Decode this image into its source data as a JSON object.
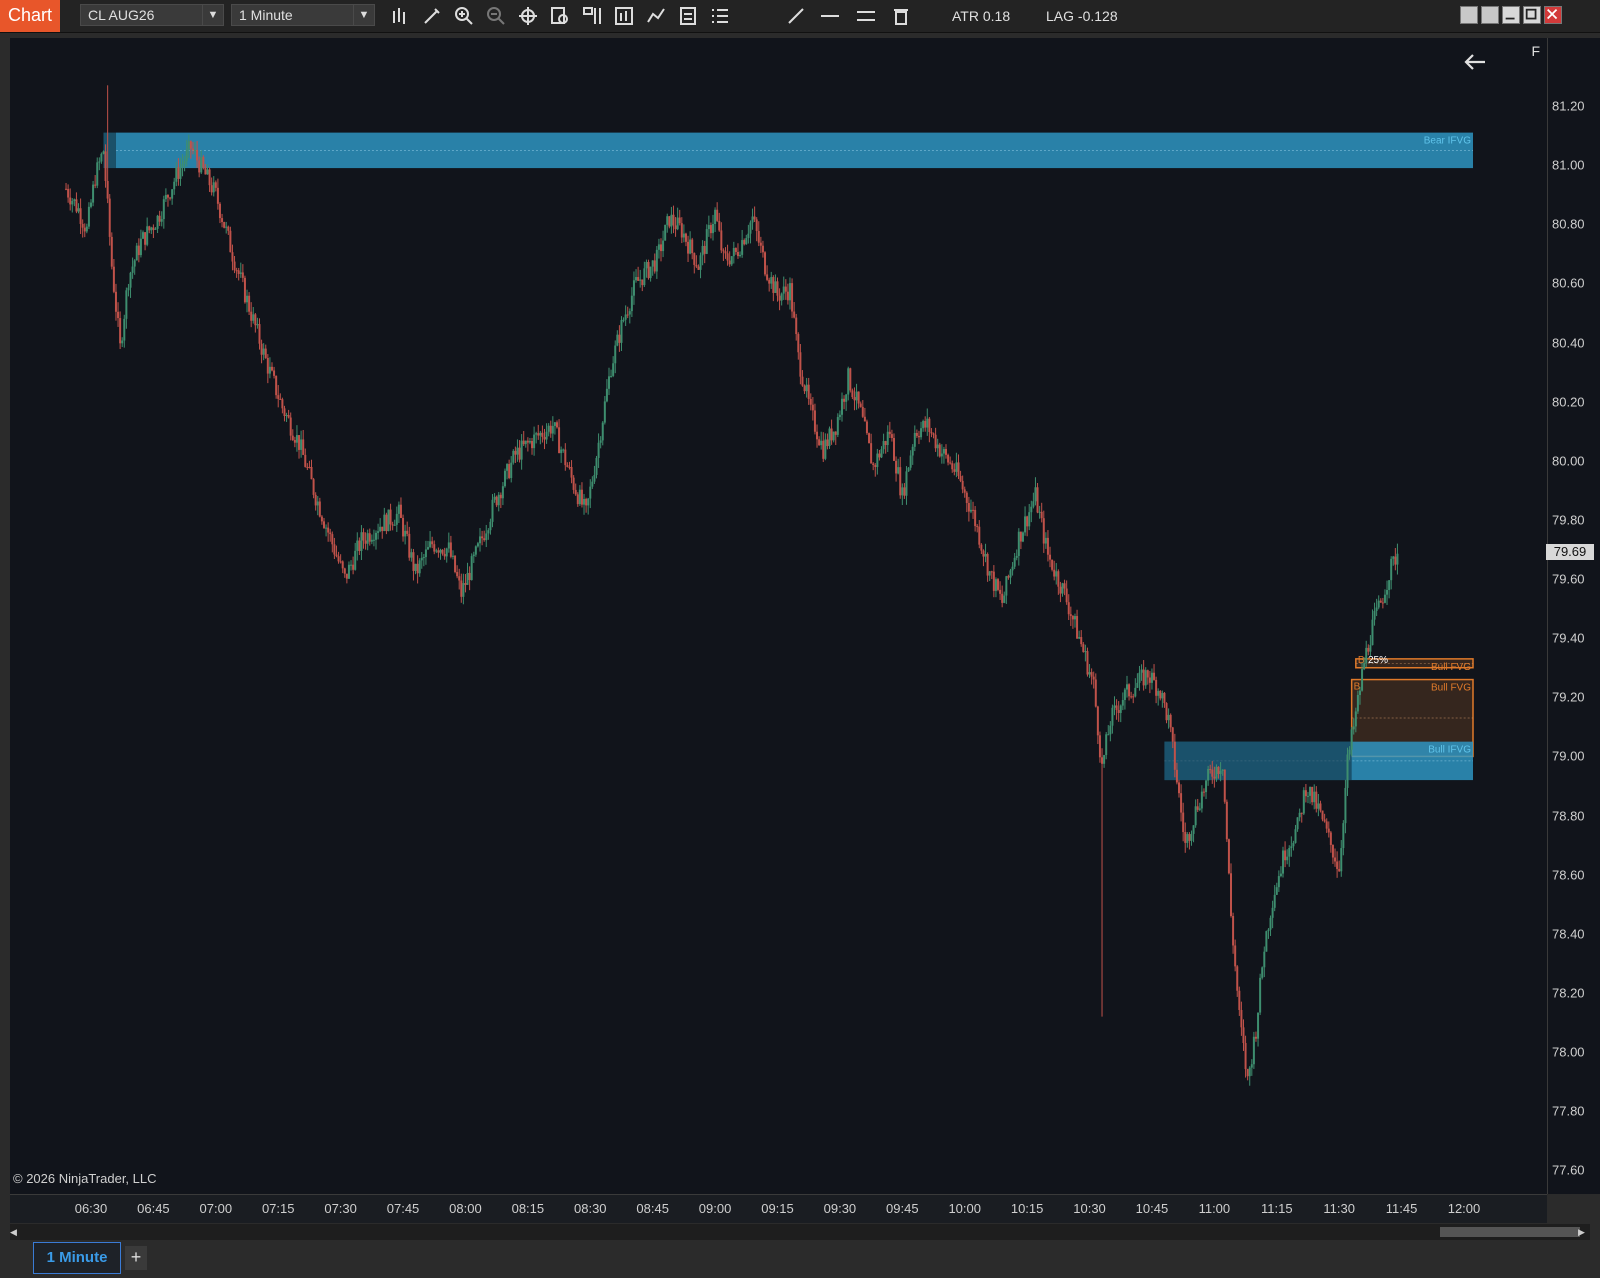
{
  "toolbar": {
    "app_label": "Chart",
    "instrument": "CL AUG26",
    "interval": "1 Minute",
    "atr": "ATR 0.18",
    "lag": "LAG -0.128"
  },
  "chart": {
    "copyright": "© 2026 NinjaTrader, LLC",
    "f_label": "F",
    "last_price": "79.69",
    "zones": {
      "bear_ifvg": "Bear IFVG",
      "bull_fvg_1": "Bull FVG",
      "bull_fvg_2": "Bull FVG",
      "bull_ifvg": "Bull IFVG",
      "pct_label": "25%",
      "marker_b1": "B",
      "marker_b2": "B"
    }
  },
  "chart_data": {
    "type": "candlestick",
    "xlabel": "",
    "ylabel": "",
    "x_ticks": [
      "06:30",
      "06:45",
      "07:00",
      "07:15",
      "07:30",
      "07:45",
      "08:00",
      "08:15",
      "08:30",
      "08:45",
      "09:00",
      "09:15",
      "09:30",
      "09:45",
      "10:00",
      "10:15",
      "10:30",
      "10:45",
      "11:00",
      "11:15",
      "11:30",
      "11:45",
      "12:00"
    ],
    "y_ticks": [
      "81.20",
      "81.00",
      "80.80",
      "80.60",
      "80.40",
      "80.20",
      "80.00",
      "79.80",
      "79.60",
      "79.40",
      "79.20",
      "79.00",
      "78.80",
      "78.60",
      "78.40",
      "78.20",
      "78.00",
      "77.80",
      "77.60"
    ],
    "ylim": [
      77.52,
      81.43
    ],
    "close_path": [
      [
        "06:24",
        80.92
      ],
      [
        "06:27",
        80.85
      ],
      [
        "06:29",
        80.78
      ],
      [
        "06:31",
        80.96
      ],
      [
        "06:33",
        81.05
      ],
      [
        "06:35",
        80.66
      ],
      [
        "06:37",
        80.38
      ],
      [
        "06:39",
        80.62
      ],
      [
        "06:42",
        80.74
      ],
      [
        "06:46",
        80.82
      ],
      [
        "06:51",
        80.98
      ],
      [
        "06:54",
        81.06
      ],
      [
        "06:57",
        80.98
      ],
      [
        "07:00",
        80.9
      ],
      [
        "07:04",
        80.7
      ],
      [
        "07:08",
        80.52
      ],
      [
        "07:12",
        80.34
      ],
      [
        "07:16",
        80.18
      ],
      [
        "07:20",
        80.06
      ],
      [
        "07:24",
        79.88
      ],
      [
        "07:28",
        79.72
      ],
      [
        "07:31",
        79.6
      ],
      [
        "07:35",
        79.73
      ],
      [
        "07:39",
        79.78
      ],
      [
        "07:44",
        79.82
      ],
      [
        "07:48",
        79.62
      ],
      [
        "07:52",
        79.72
      ],
      [
        "07:56",
        79.7
      ],
      [
        "07:59",
        79.55
      ],
      [
        "08:03",
        79.7
      ],
      [
        "08:07",
        79.86
      ],
      [
        "08:12",
        80.02
      ],
      [
        "08:17",
        80.08
      ],
      [
        "08:21",
        80.12
      ],
      [
        "08:26",
        79.92
      ],
      [
        "08:29",
        79.82
      ],
      [
        "08:32",
        80.06
      ],
      [
        "08:35",
        80.32
      ],
      [
        "08:38",
        80.48
      ],
      [
        "08:41",
        80.6
      ],
      [
        "08:46",
        80.68
      ],
      [
        "08:49",
        80.82
      ],
      [
        "08:52",
        80.78
      ],
      [
        "08:56",
        80.66
      ],
      [
        "09:00",
        80.84
      ],
      [
        "09:02",
        80.68
      ],
      [
        "09:05",
        80.7
      ],
      [
        "09:09",
        80.82
      ],
      [
        "09:12",
        80.66
      ],
      [
        "09:15",
        80.56
      ],
      [
        "09:18",
        80.58
      ],
      [
        "09:20",
        80.35
      ],
      [
        "09:23",
        80.16
      ],
      [
        "09:26",
        80.04
      ],
      [
        "09:29",
        80.12
      ],
      [
        "09:32",
        80.28
      ],
      [
        "09:35",
        80.16
      ],
      [
        "09:38",
        79.98
      ],
      [
        "09:42",
        80.1
      ],
      [
        "09:45",
        79.88
      ],
      [
        "09:48",
        80.1
      ],
      [
        "09:51",
        80.12
      ],
      [
        "09:54",
        80.04
      ],
      [
        "09:58",
        79.96
      ],
      [
        "10:02",
        79.82
      ],
      [
        "10:06",
        79.62
      ],
      [
        "10:09",
        79.52
      ],
      [
        "10:13",
        79.74
      ],
      [
        "10:17",
        79.88
      ],
      [
        "10:20",
        79.68
      ],
      [
        "10:24",
        79.55
      ],
      [
        "10:28",
        79.38
      ],
      [
        "10:31",
        79.24
      ],
      [
        "10:33",
        78.96
      ],
      [
        "10:35",
        79.12
      ],
      [
        "10:38",
        79.2
      ],
      [
        "10:41",
        79.24
      ],
      [
        "10:44",
        79.28
      ],
      [
        "10:47",
        79.22
      ],
      [
        "10:49",
        79.12
      ],
      [
        "10:51",
        78.92
      ],
      [
        "10:53",
        78.7
      ],
      [
        "10:56",
        78.84
      ],
      [
        "10:59",
        78.94
      ],
      [
        "11:02",
        78.98
      ],
      [
        "11:04",
        78.46
      ],
      [
        "11:06",
        78.12
      ],
      [
        "11:08",
        77.9
      ],
      [
        "11:10",
        78.08
      ],
      [
        "11:12",
        78.36
      ],
      [
        "11:14",
        78.52
      ],
      [
        "11:17",
        78.68
      ],
      [
        "11:20",
        78.76
      ],
      [
        "11:22",
        78.9
      ],
      [
        "11:25",
        78.82
      ],
      [
        "11:28",
        78.7
      ],
      [
        "11:30",
        78.62
      ],
      [
        "11:32",
        78.98
      ],
      [
        "11:34",
        79.14
      ],
      [
        "11:36",
        79.32
      ],
      [
        "11:38",
        79.44
      ],
      [
        "11:40",
        79.52
      ],
      [
        "11:42",
        79.62
      ],
      [
        "11:44",
        79.69
      ]
    ],
    "zones": [
      {
        "label": "Bear IFVG",
        "from_time": "06:36",
        "price_top": 81.11,
        "price_bottom": 80.99,
        "color": "#2f9ccc"
      },
      {
        "label": "Bull FVG",
        "from_time": "11:34",
        "price_top": 79.33,
        "price_bottom": 79.3,
        "color": "#e07a2a"
      },
      {
        "label": "Bull FVG",
        "from_time": "11:33",
        "price_top": 79.26,
        "price_bottom": 79.0,
        "color": "#e07a2a"
      },
      {
        "label": "Bull IFVG",
        "from_time": "10:48",
        "price_top": 79.05,
        "price_bottom": 78.92,
        "color": "#2f9ccc"
      }
    ],
    "colors": {
      "up": "#3e8e6f",
      "down": "#c0524a",
      "bg": "#11141b",
      "zone_blue": "#2f9ccc",
      "zone_orange": "#e07a2a"
    }
  }
}
